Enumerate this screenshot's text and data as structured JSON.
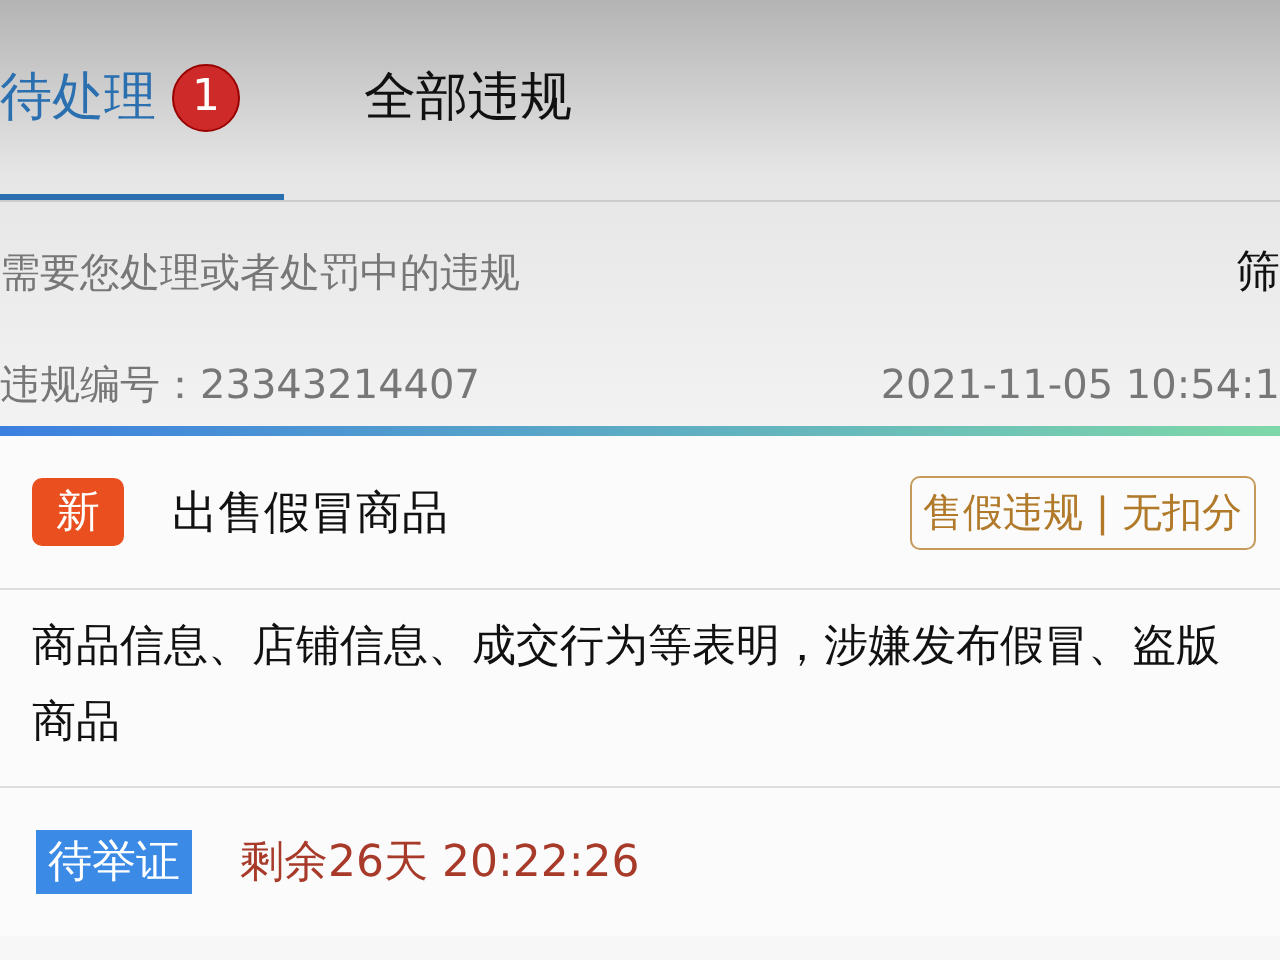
{
  "tabs": [
    {
      "label": "待处理",
      "badge": "1",
      "selected": true
    },
    {
      "label": "全部违规",
      "selected": false
    }
  ],
  "filter_bar": {
    "hint": "需要您处理或者处罚中的违规",
    "filter_button": "筛"
  },
  "violation": {
    "number": "违规编号：23343214407",
    "time": "2021-11-05 10:54:1",
    "new_tag": "新",
    "title": "出售假冒商品",
    "category": "售假违规 | 无扣分",
    "description": "商品信息、店铺信息、成交行为等表明，涉嫌发布假冒、盗版商品",
    "status": "待举证",
    "remaining": "剩余26天 20:22:26"
  }
}
